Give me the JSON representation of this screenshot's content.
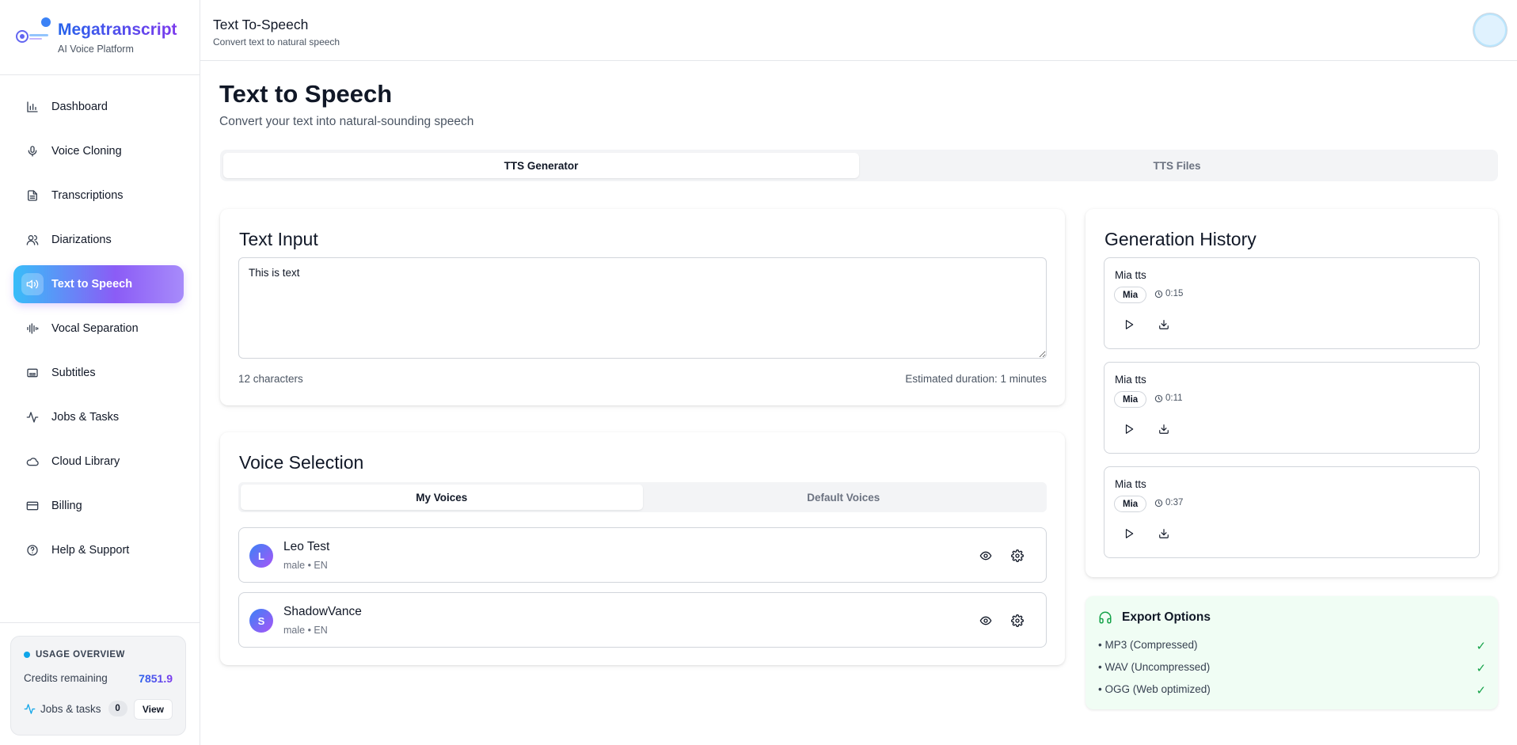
{
  "brand": {
    "name": "Megatranscript",
    "tagline": "AI Voice Platform"
  },
  "sidebar": {
    "items": [
      {
        "label": "Dashboard",
        "icon": "bar-chart-icon",
        "active": false
      },
      {
        "label": "Voice Cloning",
        "icon": "microphone-icon",
        "active": false
      },
      {
        "label": "Transcriptions",
        "icon": "document-icon",
        "active": false
      },
      {
        "label": "Diarizations",
        "icon": "users-icon",
        "active": false
      },
      {
        "label": "Text to Speech",
        "icon": "speaker-icon",
        "active": true
      },
      {
        "label": "Vocal Separation",
        "icon": "waveform-icon",
        "active": false
      },
      {
        "label": "Subtitles",
        "icon": "subtitles-icon",
        "active": false
      },
      {
        "label": "Jobs & Tasks",
        "icon": "activity-icon",
        "active": false
      },
      {
        "label": "Cloud Library",
        "icon": "cloud-icon",
        "active": false
      },
      {
        "label": "Billing",
        "icon": "credit-card-icon",
        "active": false
      },
      {
        "label": "Help & Support",
        "icon": "help-circle-icon",
        "active": false
      }
    ],
    "usage": {
      "title": "USAGE OVERVIEW",
      "credits_label": "Credits remaining",
      "credits_value": "7851.9",
      "jobs_label": "Jobs & tasks",
      "jobs_count": "0",
      "view_label": "View"
    }
  },
  "header": {
    "title": "Text To-Speech",
    "subtitle": "Convert text to natural speech"
  },
  "main": {
    "title": "Text to Speech",
    "subtitle": "Convert your text into natural-sounding speech",
    "tabs": [
      {
        "label": "TTS Generator",
        "active": true
      },
      {
        "label": "TTS Files",
        "active": false
      }
    ],
    "text_input": {
      "title": "Text Input",
      "value": "This is text",
      "char_count": "12 characters",
      "estimated": "Estimated duration: 1 minutes"
    },
    "voice_selection": {
      "title": "Voice Selection",
      "tabs": [
        {
          "label": "My Voices",
          "active": true
        },
        {
          "label": "Default Voices",
          "active": false
        }
      ],
      "voices": [
        {
          "initial": "L",
          "name": "Leo Test",
          "meta": "male • EN"
        },
        {
          "initial": "S",
          "name": "ShadowVance",
          "meta": "male • EN"
        }
      ]
    },
    "history": {
      "title": "Generation History",
      "items": [
        {
          "title": "Mia tts",
          "voice": "Mia",
          "duration": "0:15"
        },
        {
          "title": "Mia tts",
          "voice": "Mia",
          "duration": "0:11"
        },
        {
          "title": "Mia tts",
          "voice": "Mia",
          "duration": "0:37"
        }
      ]
    },
    "export": {
      "title": "Export Options",
      "options": [
        {
          "label": "• MP3 (Compressed)",
          "mark": "✓"
        },
        {
          "label": "• WAV (Uncompressed)",
          "mark": "✓"
        },
        {
          "label": "• OGG (Web optimized)",
          "mark": "✓"
        }
      ]
    }
  },
  "colors": {
    "accent_start": "#38bdf8",
    "accent_end": "#8b5cf6",
    "success": "#16a34a"
  }
}
